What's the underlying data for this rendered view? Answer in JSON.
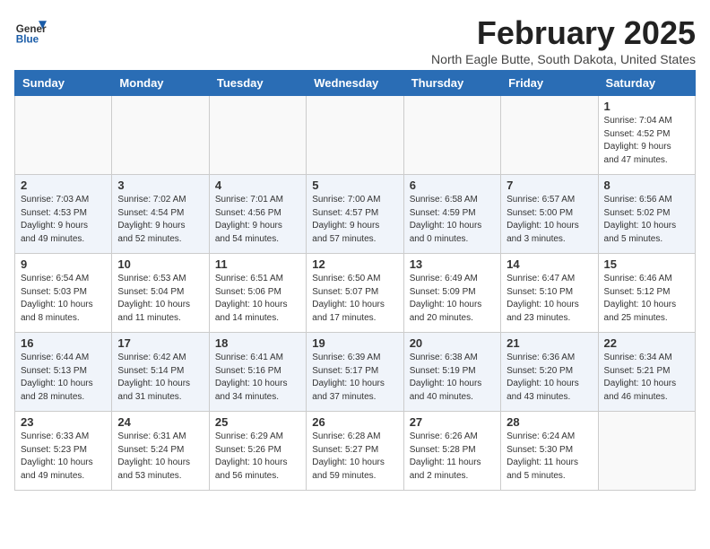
{
  "logo": {
    "general": "General",
    "blue": "Blue"
  },
  "title": "February 2025",
  "location": "North Eagle Butte, South Dakota, United States",
  "weekdays": [
    "Sunday",
    "Monday",
    "Tuesday",
    "Wednesday",
    "Thursday",
    "Friday",
    "Saturday"
  ],
  "weeks": [
    [
      {
        "day": "",
        "info": ""
      },
      {
        "day": "",
        "info": ""
      },
      {
        "day": "",
        "info": ""
      },
      {
        "day": "",
        "info": ""
      },
      {
        "day": "",
        "info": ""
      },
      {
        "day": "",
        "info": ""
      },
      {
        "day": "1",
        "info": "Sunrise: 7:04 AM\nSunset: 4:52 PM\nDaylight: 9 hours\nand 47 minutes."
      }
    ],
    [
      {
        "day": "2",
        "info": "Sunrise: 7:03 AM\nSunset: 4:53 PM\nDaylight: 9 hours\nand 49 minutes."
      },
      {
        "day": "3",
        "info": "Sunrise: 7:02 AM\nSunset: 4:54 PM\nDaylight: 9 hours\nand 52 minutes."
      },
      {
        "day": "4",
        "info": "Sunrise: 7:01 AM\nSunset: 4:56 PM\nDaylight: 9 hours\nand 54 minutes."
      },
      {
        "day": "5",
        "info": "Sunrise: 7:00 AM\nSunset: 4:57 PM\nDaylight: 9 hours\nand 57 minutes."
      },
      {
        "day": "6",
        "info": "Sunrise: 6:58 AM\nSunset: 4:59 PM\nDaylight: 10 hours\nand 0 minutes."
      },
      {
        "day": "7",
        "info": "Sunrise: 6:57 AM\nSunset: 5:00 PM\nDaylight: 10 hours\nand 3 minutes."
      },
      {
        "day": "8",
        "info": "Sunrise: 6:56 AM\nSunset: 5:02 PM\nDaylight: 10 hours\nand 5 minutes."
      }
    ],
    [
      {
        "day": "9",
        "info": "Sunrise: 6:54 AM\nSunset: 5:03 PM\nDaylight: 10 hours\nand 8 minutes."
      },
      {
        "day": "10",
        "info": "Sunrise: 6:53 AM\nSunset: 5:04 PM\nDaylight: 10 hours\nand 11 minutes."
      },
      {
        "day": "11",
        "info": "Sunrise: 6:51 AM\nSunset: 5:06 PM\nDaylight: 10 hours\nand 14 minutes."
      },
      {
        "day": "12",
        "info": "Sunrise: 6:50 AM\nSunset: 5:07 PM\nDaylight: 10 hours\nand 17 minutes."
      },
      {
        "day": "13",
        "info": "Sunrise: 6:49 AM\nSunset: 5:09 PM\nDaylight: 10 hours\nand 20 minutes."
      },
      {
        "day": "14",
        "info": "Sunrise: 6:47 AM\nSunset: 5:10 PM\nDaylight: 10 hours\nand 23 minutes."
      },
      {
        "day": "15",
        "info": "Sunrise: 6:46 AM\nSunset: 5:12 PM\nDaylight: 10 hours\nand 25 minutes."
      }
    ],
    [
      {
        "day": "16",
        "info": "Sunrise: 6:44 AM\nSunset: 5:13 PM\nDaylight: 10 hours\nand 28 minutes."
      },
      {
        "day": "17",
        "info": "Sunrise: 6:42 AM\nSunset: 5:14 PM\nDaylight: 10 hours\nand 31 minutes."
      },
      {
        "day": "18",
        "info": "Sunrise: 6:41 AM\nSunset: 5:16 PM\nDaylight: 10 hours\nand 34 minutes."
      },
      {
        "day": "19",
        "info": "Sunrise: 6:39 AM\nSunset: 5:17 PM\nDaylight: 10 hours\nand 37 minutes."
      },
      {
        "day": "20",
        "info": "Sunrise: 6:38 AM\nSunset: 5:19 PM\nDaylight: 10 hours\nand 40 minutes."
      },
      {
        "day": "21",
        "info": "Sunrise: 6:36 AM\nSunset: 5:20 PM\nDaylight: 10 hours\nand 43 minutes."
      },
      {
        "day": "22",
        "info": "Sunrise: 6:34 AM\nSunset: 5:21 PM\nDaylight: 10 hours\nand 46 minutes."
      }
    ],
    [
      {
        "day": "23",
        "info": "Sunrise: 6:33 AM\nSunset: 5:23 PM\nDaylight: 10 hours\nand 49 minutes."
      },
      {
        "day": "24",
        "info": "Sunrise: 6:31 AM\nSunset: 5:24 PM\nDaylight: 10 hours\nand 53 minutes."
      },
      {
        "day": "25",
        "info": "Sunrise: 6:29 AM\nSunset: 5:26 PM\nDaylight: 10 hours\nand 56 minutes."
      },
      {
        "day": "26",
        "info": "Sunrise: 6:28 AM\nSunset: 5:27 PM\nDaylight: 10 hours\nand 59 minutes."
      },
      {
        "day": "27",
        "info": "Sunrise: 6:26 AM\nSunset: 5:28 PM\nDaylight: 11 hours\nand 2 minutes."
      },
      {
        "day": "28",
        "info": "Sunrise: 6:24 AM\nSunset: 5:30 PM\nDaylight: 11 hours\nand 5 minutes."
      },
      {
        "day": "",
        "info": ""
      }
    ]
  ]
}
